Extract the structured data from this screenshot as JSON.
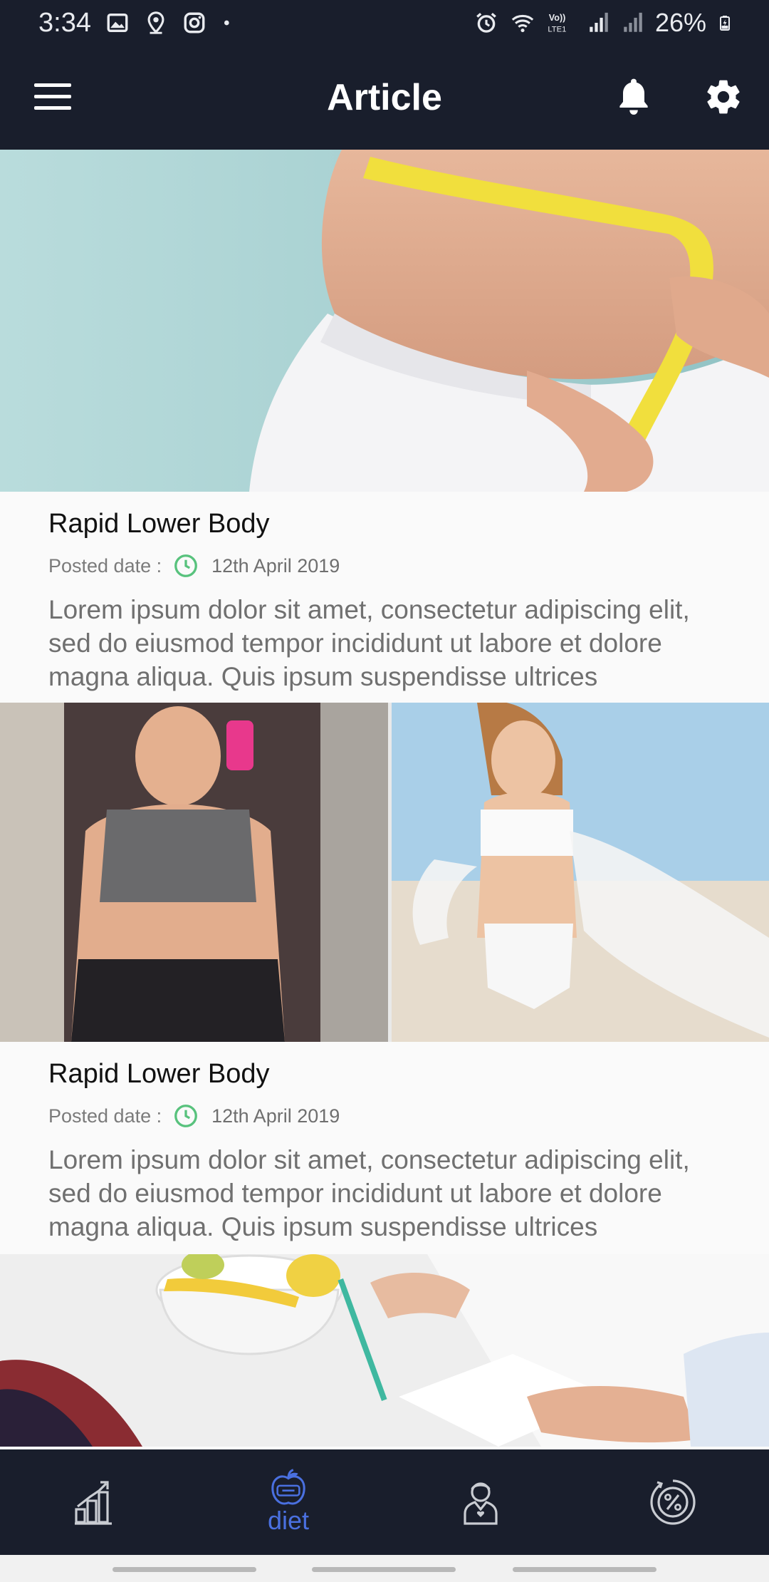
{
  "status_bar": {
    "time": "3:34",
    "battery": "26%",
    "left_icons": [
      "image-icon",
      "location-icon",
      "instagram-icon",
      "dot-icon"
    ],
    "right_icons": [
      "alarm-icon",
      "wifi-icon",
      "volte-icon",
      "signal-icon",
      "signal-icon",
      "battery-charging-icon"
    ]
  },
  "app_bar": {
    "title": "Article",
    "left_icon": "menu-icon",
    "right_icons": [
      "bell-icon",
      "gear-icon"
    ]
  },
  "articles": [
    {
      "image": "photo of waist with yellow measuring tape",
      "title": "Rapid Lower Body",
      "date_label": "Posted date :",
      "date": "12th April 2019",
      "excerpt": "Lorem ipsum dolor sit amet, consectetur adipiscing elit, sed do eiusmod tempor incididunt ut labore et dolore magna aliqua. Quis ipsum suspendisse ultrices"
    },
    {
      "image": "before and after weight loss photos",
      "title": "Rapid Lower Body",
      "date_label": "Posted date :",
      "date": "12th April 2019",
      "excerpt": "Lorem ipsum dolor sit amet, consectetur adipiscing elit, sed do eiusmod tempor incididunt ut labore et dolore magna aliqua. Quis ipsum suspendisse ultrices"
    },
    {
      "image": "doctor writing a diet plan next to a fruit bowl"
    }
  ],
  "bottom_nav": {
    "items": [
      {
        "icon": "progress-chart-icon",
        "label": "",
        "active": false
      },
      {
        "icon": "apple-scale-icon",
        "label": "diet",
        "active": true
      },
      {
        "icon": "doctor-icon",
        "label": "",
        "active": false
      },
      {
        "icon": "discount-icon",
        "label": "",
        "active": false
      }
    ]
  },
  "colors": {
    "header_bg": "#191e2c",
    "accent": "#4a70e0",
    "clock_green": "#58c27d",
    "body_bg": "#fafafa"
  }
}
